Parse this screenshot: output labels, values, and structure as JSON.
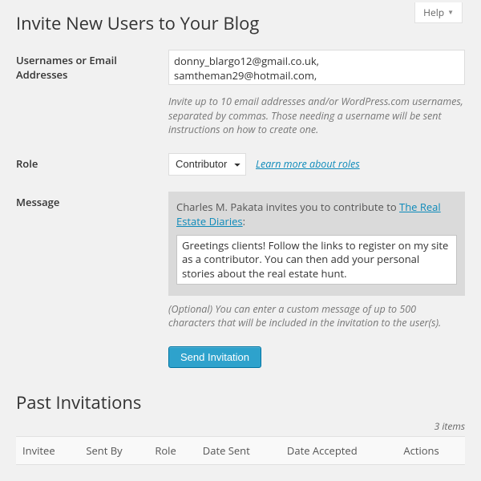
{
  "help_label": "Help",
  "page_title": "Invite New Users to Your Blog",
  "form": {
    "emails_label": "Usernames or Email Addresses",
    "emails_value": "donny_blargo12@gmail.co.uk, samtheman29@hotmail.com, lisa_d_luce@cpatrecticsystems.org",
    "emails_help": "Invite up to 10 email addresses and/or WordPress.com usernames, separated by commas. Those needing a username will be sent instructions on how to create one.",
    "role_label": "Role",
    "role_value": "Contributor",
    "role_link": "Learn more about roles",
    "message_label": "Message",
    "message_intro_prefix": "Charles M. Pakata invites you to contribute to ",
    "message_intro_link": "The Real Estate Diaries",
    "message_intro_suffix": ":",
    "message_value": "Greetings clients! Follow the links to register on my site as a contributor. You can then add your personal stories about the real estate hunt.",
    "message_help": "(Optional) You can enter a custom message of up to 500 characters that will be included in the invitation to the user(s).",
    "submit_label": "Send Invitation"
  },
  "past": {
    "title": "Past Invitations",
    "count_text": "3 items",
    "columns": {
      "invitee": "Invitee",
      "sent_by": "Sent By",
      "role": "Role",
      "date_sent": "Date Sent",
      "date_accepted": "Date Accepted",
      "actions": "Actions"
    }
  }
}
